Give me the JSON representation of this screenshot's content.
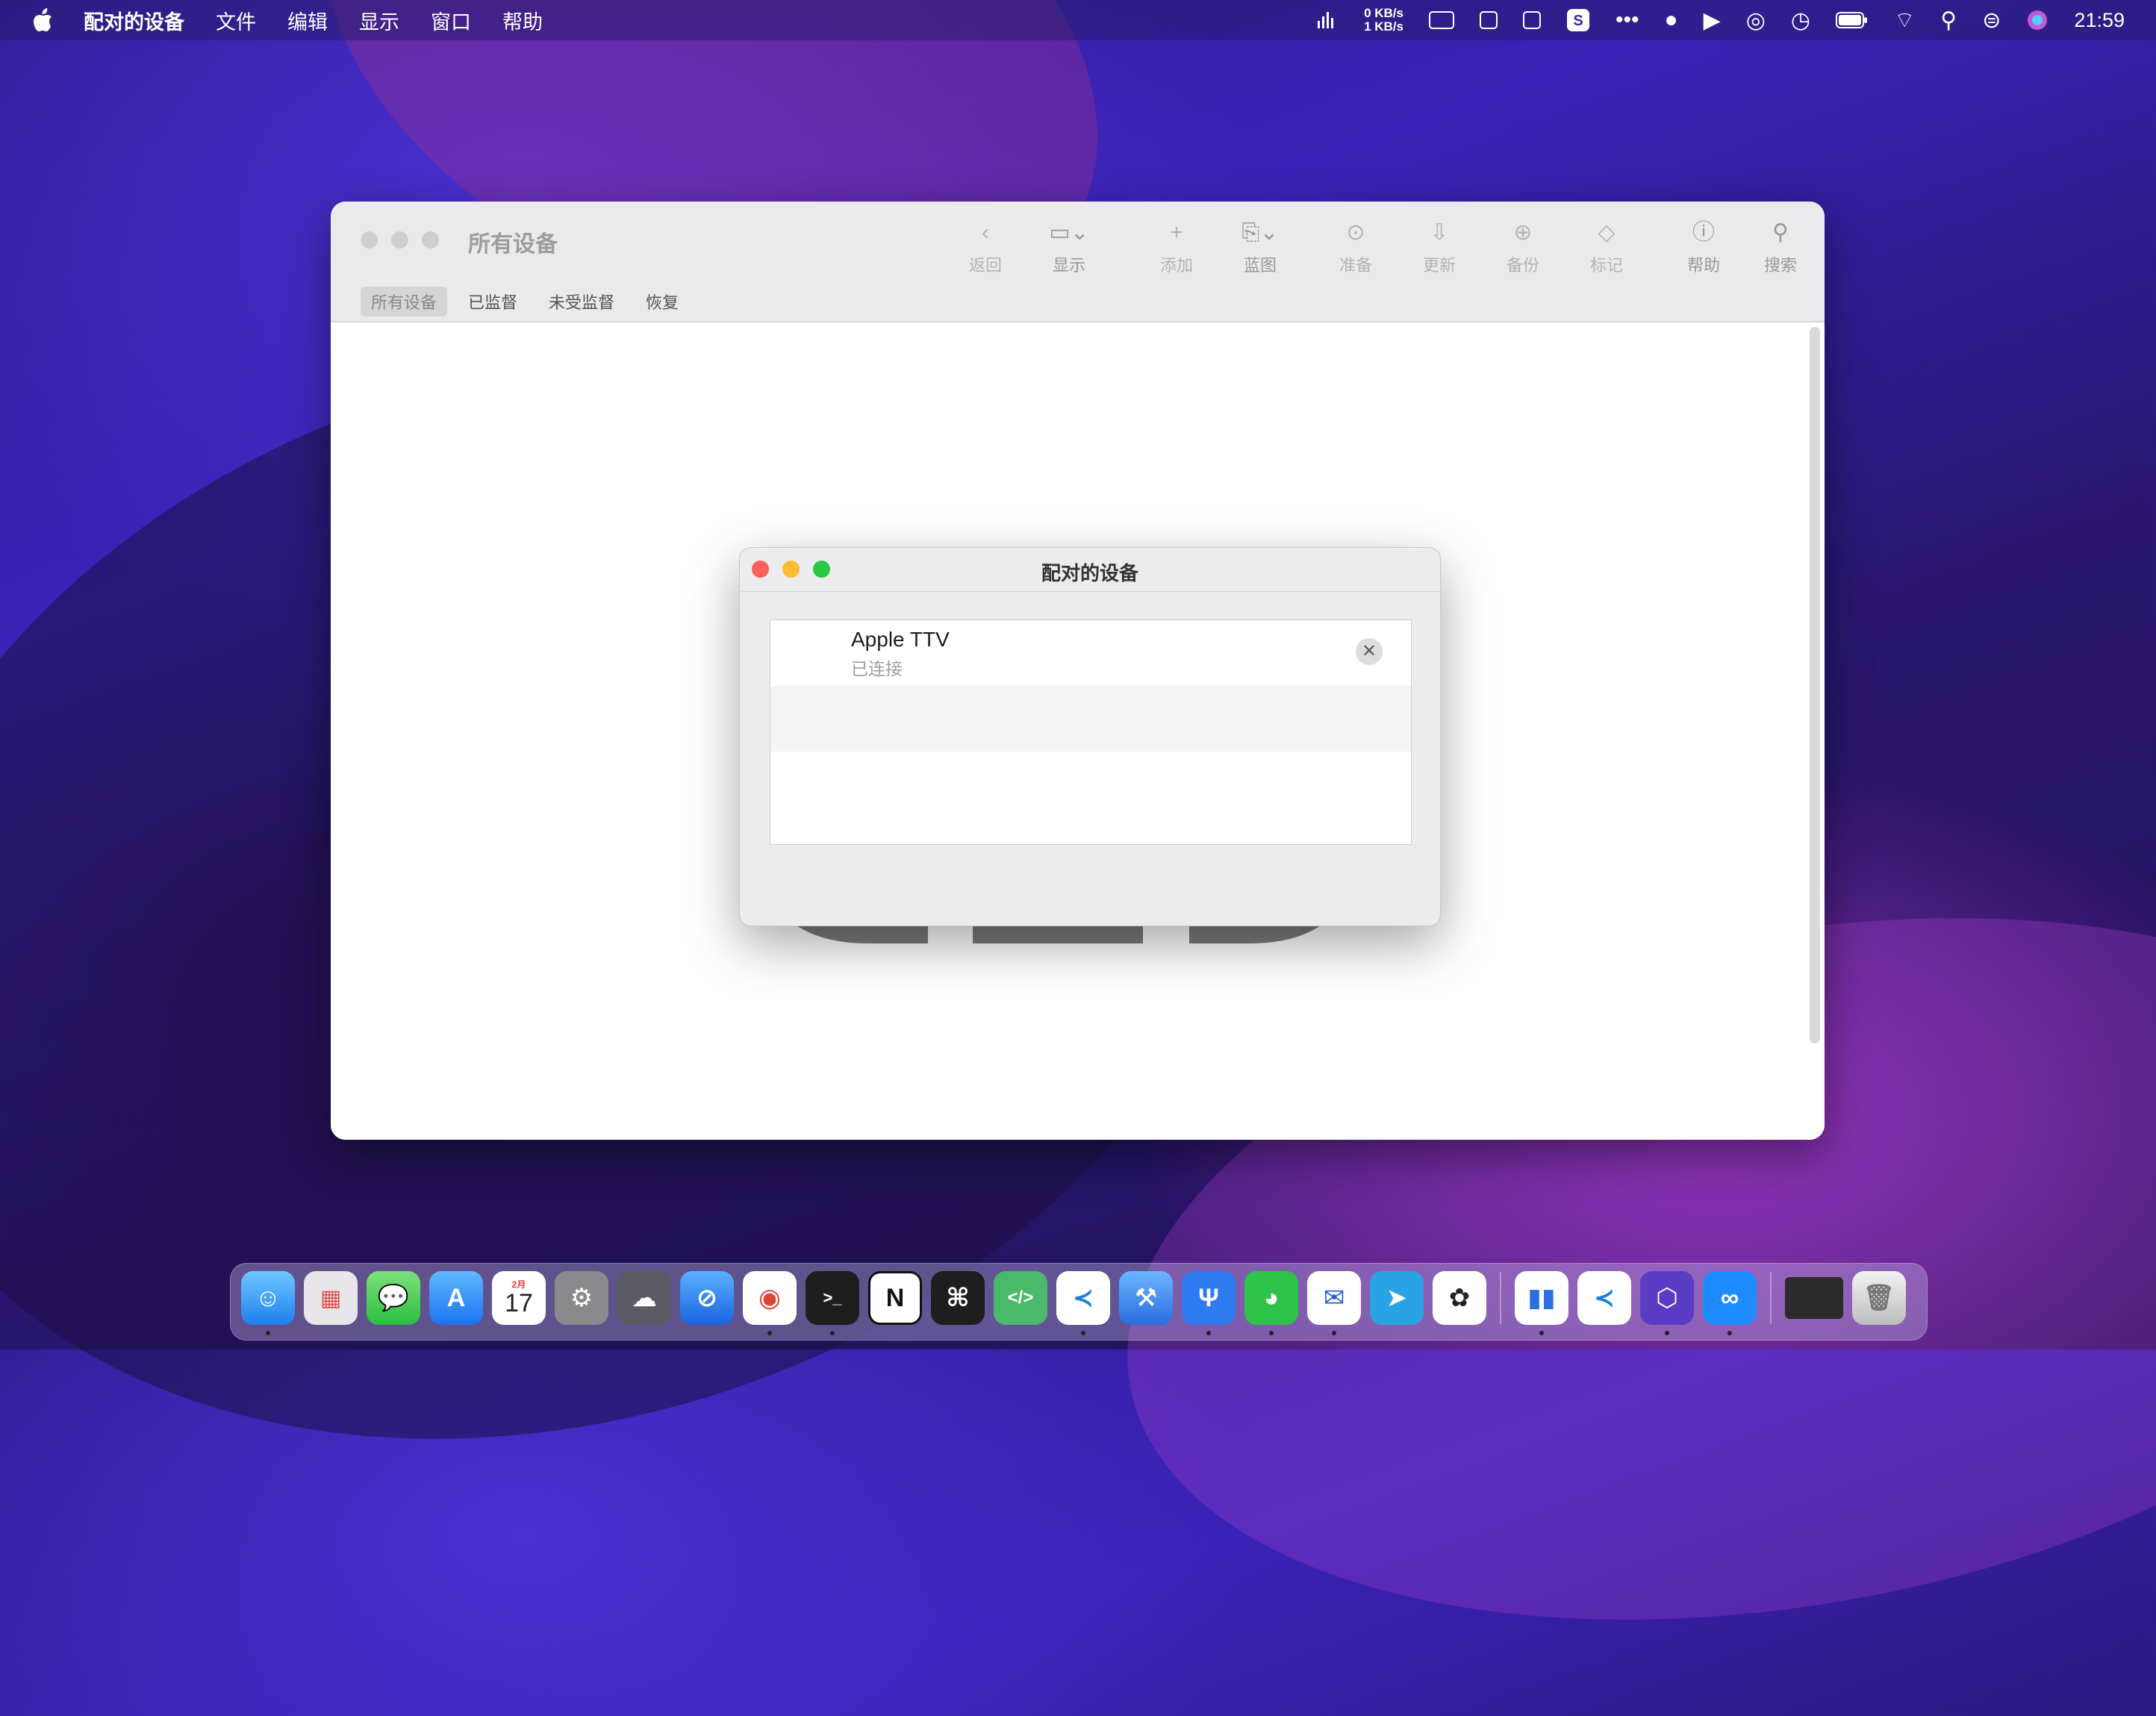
{
  "menubar": {
    "app_name": "配对的设备",
    "items": [
      "文件",
      "编辑",
      "显示",
      "窗口",
      "帮助"
    ],
    "net_up": "0 KB/s",
    "net_down": "1 KB/s",
    "clock": "21:59"
  },
  "main_window": {
    "title": "所有设备",
    "toolbar": [
      {
        "label": "返回",
        "icon": "chevron-left-icon"
      },
      {
        "label": "显示",
        "icon": "window-icon"
      },
      {
        "label": "添加",
        "icon": "plus-icon"
      },
      {
        "label": "蓝图",
        "icon": "blueprint-icon"
      },
      {
        "label": "准备",
        "icon": "prepare-icon"
      },
      {
        "label": "更新",
        "icon": "update-icon"
      },
      {
        "label": "备份",
        "icon": "backup-icon"
      },
      {
        "label": "标记",
        "icon": "tag-icon"
      },
      {
        "label": "帮助",
        "icon": "help-icon"
      },
      {
        "label": "搜索",
        "icon": "search-icon"
      }
    ],
    "tabs": [
      "所有设备",
      "已监督",
      "未受监督",
      "恢复"
    ]
  },
  "sheet": {
    "title": "配对的设备",
    "devices": [
      {
        "name": "Apple TTV",
        "status": "已连接"
      }
    ]
  },
  "dock": {
    "apps": [
      "Finder",
      "Launchpad",
      "Messages",
      "App Store",
      "Calendar",
      "System Preferences",
      "Cloud",
      "Safari",
      "Chrome",
      "Terminal",
      "Notion",
      "Keyboard",
      "Code Editor",
      "VS Code",
      "Xcode",
      "Fork",
      "WeChat",
      "Mail",
      "Telegram",
      "ChatGPT",
      "Stats",
      "VS Code Insiders",
      "Apple Configurator",
      "Link",
      "Screen",
      "Trash"
    ],
    "calendar_month": "2月",
    "calendar_day": "17"
  },
  "colors": {
    "close": "#fe5f57",
    "minimize": "#febc2e",
    "maximize": "#28c840"
  }
}
